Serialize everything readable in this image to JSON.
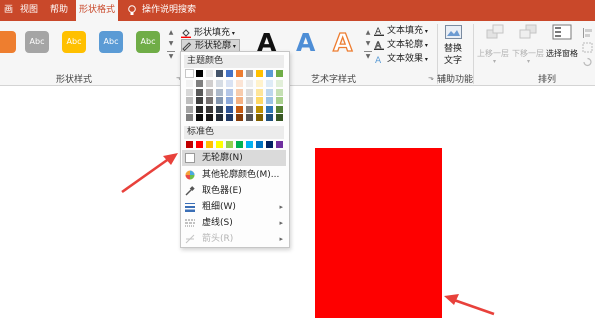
{
  "tabs": [
    {
      "label": "画"
    },
    {
      "label": "视图"
    },
    {
      "label": "帮助"
    },
    {
      "label": "形状格式"
    },
    {
      "label": "操作说明搜索"
    }
  ],
  "shape_styles": {
    "swatches": [
      {
        "label": "",
        "color": "#ee7e2f"
      },
      {
        "label": "Abc",
        "color": "#a5a5a5"
      },
      {
        "label": "Abc",
        "color": "#ffc000"
      },
      {
        "label": "Abc",
        "color": "#5b9bd5"
      },
      {
        "label": "Abc",
        "color": "#70ad47"
      }
    ],
    "fill_label": "形状填充",
    "outline_label": "形状轮廓",
    "group_label": "形状样式"
  },
  "wordart": {
    "letters": [
      "A",
      "A",
      "A"
    ],
    "text_fill": "文本填充",
    "text_outline": "文本轮廓",
    "text_effects": "文本效果",
    "group_label": "艺术字样式"
  },
  "alt_text": {
    "line1": "替换",
    "line2": "文字",
    "group_label": "辅助功能"
  },
  "arrange": {
    "bring_forward": "上移一层",
    "send_backward": "下移一层",
    "selection_pane": "选择窗格",
    "group_label": "排列"
  },
  "outline_menu": {
    "theme_colors_label": "主题颜色",
    "theme_colors": [
      [
        "#ffffff",
        "#000000",
        "#e7e6e6",
        "#44546a",
        "#4472c4",
        "#ed7d31",
        "#a5a5a5",
        "#ffc000",
        "#5b9bd5",
        "#70ad47"
      ],
      [
        "#f2f2f2",
        "#7f7f7f",
        "#d0cece",
        "#d6dce4",
        "#d9e2f3",
        "#fbe4d5",
        "#ededed",
        "#fff2cc",
        "#deebf6",
        "#e2efd9"
      ],
      [
        "#d8d8d8",
        "#595959",
        "#aeabab",
        "#adb9ca",
        "#b4c6e7",
        "#f7cbac",
        "#dbdbdb",
        "#fee599",
        "#bdd7ee",
        "#c5e0b3"
      ],
      [
        "#bfbfbf",
        "#3f3f3f",
        "#757070",
        "#8496b0",
        "#8eaadb",
        "#f4b183",
        "#c9c9c9",
        "#ffd965",
        "#9cc3e5",
        "#a8d08d"
      ],
      [
        "#a5a5a5",
        "#262626",
        "#3a3838",
        "#323f4f",
        "#2f5496",
        "#c55a11",
        "#7b7b7b",
        "#bf9000",
        "#2e75b5",
        "#538135"
      ],
      [
        "#7f7f7f",
        "#0c0c0c",
        "#171616",
        "#222a35",
        "#1f3864",
        "#833c0b",
        "#525252",
        "#7f6000",
        "#1e4e79",
        "#375623"
      ]
    ],
    "standard_colors_label": "标准色",
    "standard_colors": [
      "#c00000",
      "#ff0000",
      "#ffc000",
      "#ffff00",
      "#92d050",
      "#00b050",
      "#00b0f0",
      "#0070c0",
      "#002060",
      "#7030a0"
    ],
    "items": [
      {
        "label": "无轮廓(N)",
        "icon": "no-outline-icon"
      },
      {
        "label": "其他轮廓颜色(M)...",
        "icon": "color-wheel-icon"
      },
      {
        "label": "取色器(E)",
        "icon": "eyedropper-icon"
      },
      {
        "label": "粗细(W)",
        "icon": "line-weight-icon"
      },
      {
        "label": "虚线(S)",
        "icon": "dash-icon"
      },
      {
        "label": "箭头(R)",
        "icon": "arrow-style-icon"
      }
    ]
  },
  "colors": {
    "accent": "#c9482a",
    "shape_fill": "#fe0000",
    "annotation_arrow": "#e8413b"
  }
}
